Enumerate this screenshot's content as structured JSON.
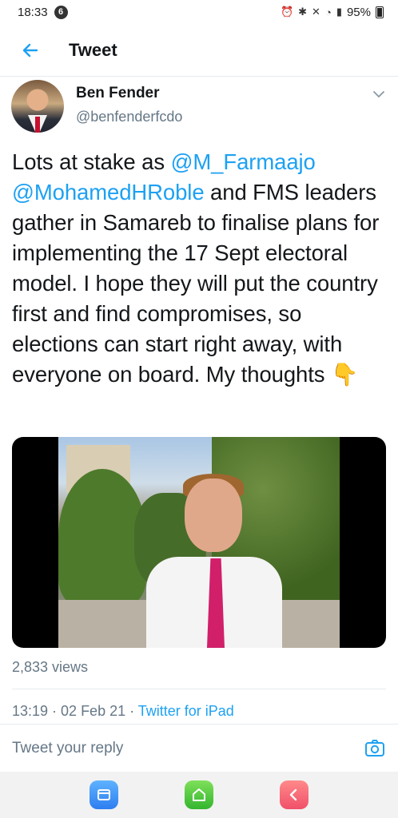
{
  "status": {
    "time": "18:33",
    "notification_count": "6",
    "battery": "95%"
  },
  "header": {
    "title": "Tweet"
  },
  "tweet": {
    "author_name": "Ben Fender",
    "author_handle": "@benfenderfcdo",
    "text_1": "Lots at stake as ",
    "mention_1": "@M_Farmaajo",
    "mention_2": "@MohamedHRoble",
    "text_2": " and FMS leaders gather in Samareb to finalise plans for implementing the 17 Sept electoral model.   I hope they will put the country first and find compromises, so elections can start right away, with everyone on board.   My thoughts ",
    "emoji": "👇",
    "views": "2,833 views",
    "timestamp": "13:19 · 02 Feb 21 · ",
    "source": "Twitter for iPad"
  },
  "reply": {
    "placeholder": "Tweet your reply"
  },
  "icons": {
    "back": "arrow-left-icon",
    "caret": "chevron-down-icon",
    "camera": "camera-icon",
    "nav_recents": "recents-icon",
    "nav_home": "home-icon",
    "nav_back": "nav-back-icon"
  },
  "colors": {
    "accent": "#1da1f2",
    "text": "#14171a",
    "secondary": "#657786"
  }
}
